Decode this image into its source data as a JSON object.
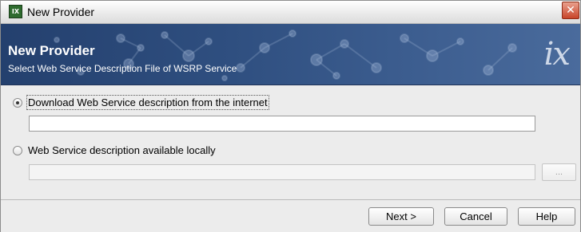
{
  "window": {
    "title": "New Provider",
    "icon": "app-icon",
    "icon_glyph": "IX",
    "close_glyph": "✕"
  },
  "banner": {
    "title": "New Provider",
    "subtitle": "Select Web Service Description File of WSRP Service",
    "logo_text": "ix"
  },
  "options": [
    {
      "label": "Download Web Service description from the internet",
      "selected": true,
      "value": ""
    },
    {
      "label": "Web Service description available locally",
      "selected": false,
      "value": "",
      "browse_label": "..."
    }
  ],
  "buttons": {
    "next": "Next >",
    "cancel": "Cancel",
    "help": "Help"
  },
  "colors": {
    "banner_bg": "#2f4f80",
    "close_button": "#c8452a",
    "dialog_bg": "#ececec"
  }
}
